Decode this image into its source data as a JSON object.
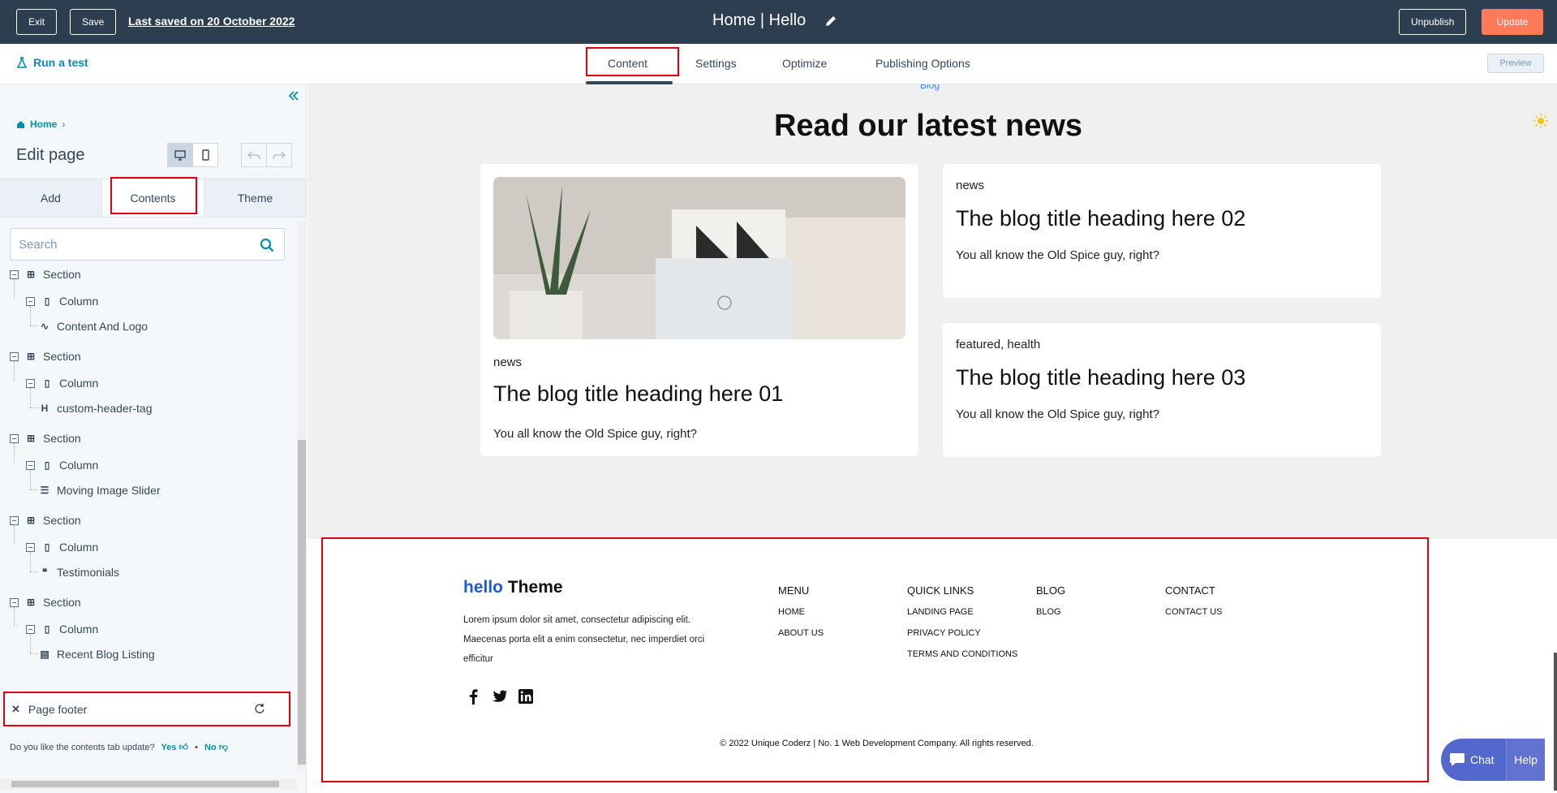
{
  "topbar": {
    "exit_label": "Exit",
    "save_label": "Save",
    "last_saved": "Last saved on 20 October 2022",
    "page_title": "Home | Hello",
    "unpublish_label": "Unpublish",
    "update_label": "Update"
  },
  "subnav": {
    "run_test": "Run a test",
    "tabs": [
      {
        "label": "Content"
      },
      {
        "label": "Settings"
      },
      {
        "label": "Optimize"
      },
      {
        "label": "Publishing Options"
      }
    ],
    "preview_label": "Preview"
  },
  "sidebar": {
    "breadcrumb": "Home",
    "title": "Edit page",
    "tabs": [
      {
        "label": "Add"
      },
      {
        "label": "Contents"
      },
      {
        "label": "Theme"
      }
    ],
    "search_placeholder": "Search",
    "tree": [
      {
        "section": "Section",
        "column": "Column",
        "module": "Content And Logo",
        "module_icon": "zigzag-icon"
      },
      {
        "section": "Section",
        "column": "Column",
        "module": "custom-header-tag",
        "module_icon": "heading-icon"
      },
      {
        "section": "Section",
        "column": "Column",
        "module": "Moving Image Slider",
        "module_icon": "slider-icon"
      },
      {
        "section": "Section",
        "column": "Column",
        "module": "Testimonials",
        "module_icon": "quote-icon"
      },
      {
        "section": "Section",
        "column": "Column",
        "module": "Recent Blog Listing",
        "module_icon": "card-icon"
      }
    ],
    "footer_node": "Page footer",
    "feedback": {
      "question": "Do you like the contents tab update?",
      "yes": "Yes",
      "no": "No"
    }
  },
  "canvas": {
    "blog_tag": "Blog",
    "heading": "Read our latest news",
    "cards": [
      {
        "category": "news",
        "title": "The blog title heading here 01",
        "excerpt": "You all know the Old Spice guy, right?"
      },
      {
        "category": "news",
        "title": "The blog title heading here 02",
        "excerpt": "You all know the Old Spice guy, right?"
      },
      {
        "category": "featured, health",
        "title": "The blog title heading here 03",
        "excerpt": "You all know the Old Spice guy, right?"
      }
    ],
    "footer": {
      "logo_hello": "hello",
      "logo_theme": "Theme",
      "description": "Lorem ipsum dolor sit amet, consectetur adipiscing elit. Maecenas porta elit a enim consectetur, nec imperdiet orci efficitur",
      "columns": [
        {
          "heading": "MENU",
          "links": [
            "HOME",
            "ABOUT US"
          ]
        },
        {
          "heading": "QUICK LINKS",
          "links": [
            "LANDING PAGE",
            "PRIVACY POLICY",
            "TERMS AND CONDITIONS"
          ]
        },
        {
          "heading": "BLOG",
          "links": [
            "BLOG"
          ]
        },
        {
          "heading": "CONTACT",
          "links": [
            "CONTACT US"
          ]
        }
      ],
      "copyright": "© 2022 Unique Coderz | No. 1 Web Development Company. All rights reserved."
    }
  },
  "chat": {
    "chat_label": "Chat",
    "help_label": "Help"
  },
  "colors": {
    "topbar": "#2d3e50",
    "accent": "#ff7a59",
    "link": "#0091ae",
    "highlight": "#e3000f"
  }
}
